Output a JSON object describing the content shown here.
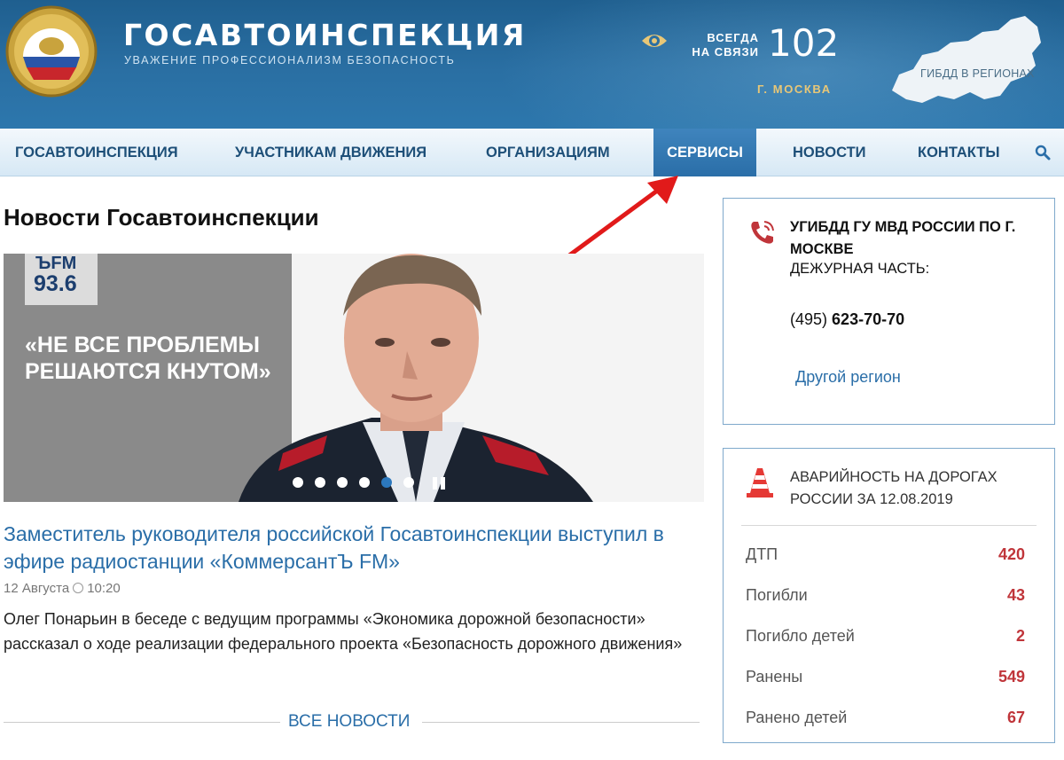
{
  "header": {
    "title": "ГОСАВТОИНСПЕКЦИЯ",
    "subtitle": "УВАЖЕНИЕ ПРОФЕССИОНАЛИЗМ БЕЗОПАСНОСТЬ",
    "always_line1": "ВСЕГДА",
    "always_line2": "НА СВЯЗИ",
    "phone": "102",
    "city": "Г. МОСКВА",
    "regions_label": "ГИБДД В РЕГИОНАХ",
    "icons": [
      "emblem-icon",
      "eye-icon",
      "russia-map-icon"
    ]
  },
  "nav": {
    "items": [
      {
        "label": "ГОСАВТОИНСПЕКЦИЯ"
      },
      {
        "label": "УЧАСТНИКАМ ДВИЖЕНИЯ"
      },
      {
        "label": "ОРГАНИЗАЦИЯМ"
      },
      {
        "label": "СЕРВИСЫ",
        "active": true
      },
      {
        "label": "НОВОСТИ"
      },
      {
        "label": "КОНТАКТЫ"
      }
    ],
    "search_icon": "search-icon"
  },
  "news": {
    "heading": "Новости Госавтоинспекции",
    "slide": {
      "radio_name": "ЪFM",
      "radio_freq": "93.6",
      "quote": "«НЕ ВСЕ ПРОБЛЕМЫ РЕШАЮТСЯ КНУТОМ»",
      "dots_count": 6,
      "active_dot": 5
    },
    "title": "Заместитель руководителя российской Госавтоинспекции выступил в эфире радиостанции «КоммерсантЪ FM»",
    "date": "12 Августа",
    "time": "10:20",
    "text": "Олег Понарьин в беседе с ведущим программы «Экономика дорожной безопасности» рассказал о ходе реализации федерального проекта «Безопасность дорожного движения»",
    "all_news": "ВСЕ НОВОСТИ"
  },
  "contact": {
    "department": "УГИБДД ГУ МВД РОССИИ ПО Г. МОСКВЕ",
    "duty_label": "ДЕЖУРНАЯ ЧАСТЬ:",
    "phone_code": "(495)",
    "phone_number": "623-70-70",
    "other_region": "Другой регион"
  },
  "accidents": {
    "title": "АВАРИЙНОСТЬ НА ДОРОГАХ РОССИИ ЗА 12.08.2019",
    "stats": [
      {
        "label": "ДТП",
        "value": "420"
      },
      {
        "label": "Погибли",
        "value": "43"
      },
      {
        "label": "Погибло детей",
        "value": "2"
      },
      {
        "label": "Ранены",
        "value": "549"
      },
      {
        "label": "Ранено детей",
        "value": "67"
      }
    ]
  },
  "colors": {
    "header_blue": "#2a6fa3",
    "nav_text": "#1d4f78",
    "link_blue": "#2a6ea8",
    "stat_red": "#c0353a",
    "city_gold": "#e8c777"
  }
}
